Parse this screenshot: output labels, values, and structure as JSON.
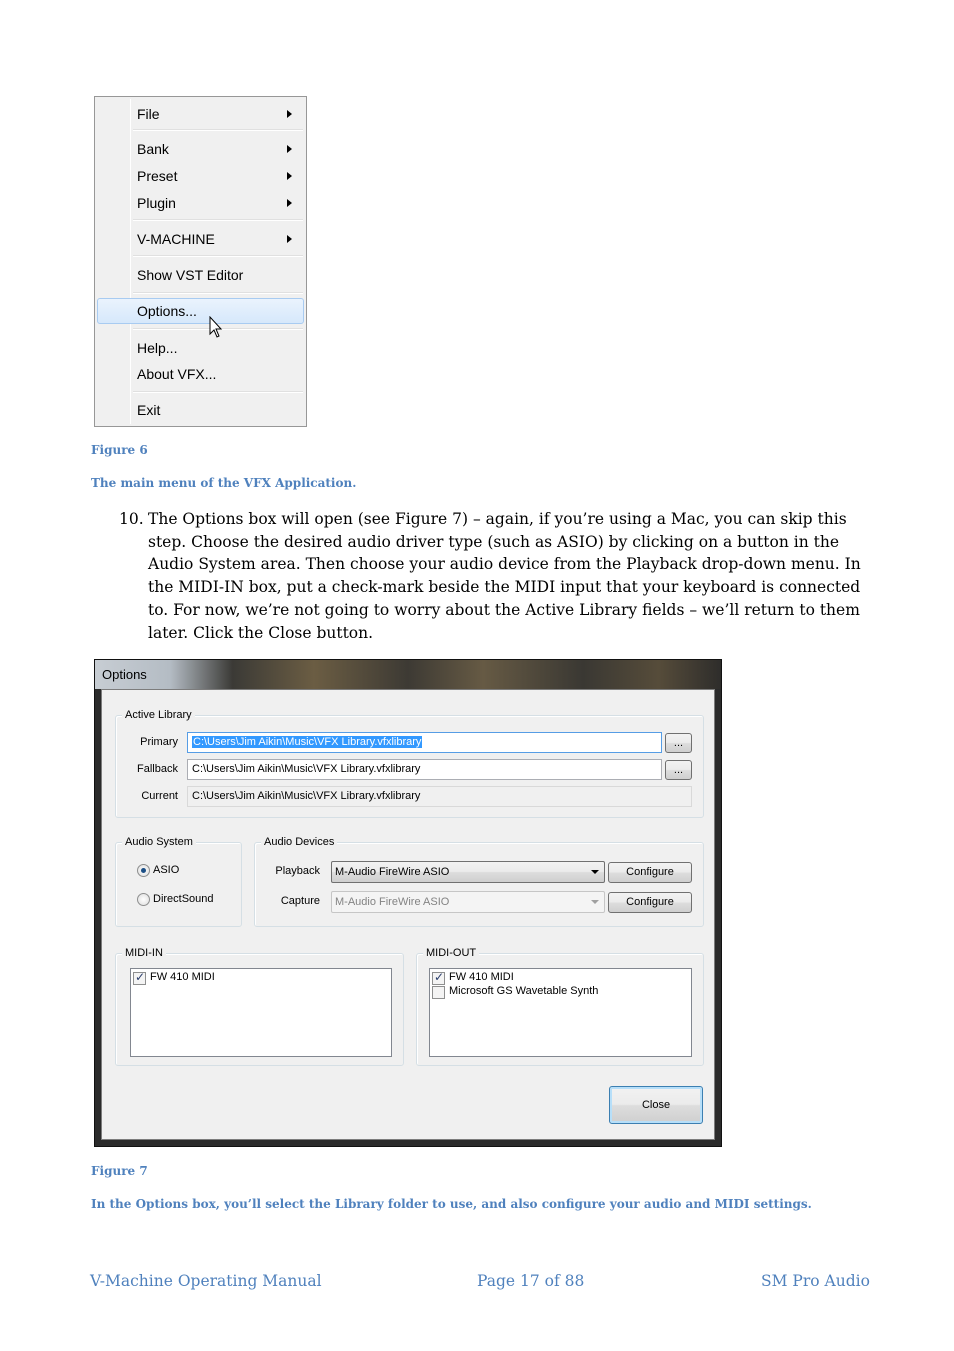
{
  "menu": {
    "items": [
      {
        "label": "File",
        "submenu": true
      },
      {
        "label": "Bank",
        "submenu": true
      },
      {
        "label": "Preset",
        "submenu": true
      },
      {
        "label": "Plugin",
        "submenu": true
      },
      {
        "label": "V-MACHINE",
        "submenu": true
      },
      {
        "label": "Show VST Editor",
        "submenu": false
      },
      {
        "label": "Options...",
        "submenu": false,
        "highlighted": true
      },
      {
        "label": "Help...",
        "submenu": false
      },
      {
        "label": "About VFX...",
        "submenu": false
      },
      {
        "label": "Exit",
        "submenu": false
      }
    ]
  },
  "figure6": {
    "label": "Figure 6",
    "caption": "The main menu of the VFX Application."
  },
  "step": {
    "number": "10.",
    "text": "The Options box will open (see Figure 7) – again, if you’re using a Mac, you can skip this step. Choose the desired audio driver type (such as ASIO) by clicking on a button in the Audio System area. Then choose your audio device from the Playback drop-down menu. In the MIDI-IN box, put a check-mark beside the MIDI input that your keyboard is connected to. For now, we’re not going to worry about the Active Library fields – we’ll return to them later. Click the Close button."
  },
  "dialog": {
    "title": "Options",
    "active_library": {
      "legend": "Active Library",
      "primary_label": "Primary",
      "primary_value": "C:\\Users\\Jim Aikin\\Music\\VFX Library.vfxlibrary",
      "fallback_label": "Fallback",
      "fallback_value": "C:\\Users\\Jim Aikin\\Music\\VFX Library.vfxlibrary",
      "current_label": "Current",
      "current_value": "C:\\Users\\Jim Aikin\\Music\\VFX Library.vfxlibrary",
      "browse_label": "..."
    },
    "audio_system": {
      "legend": "Audio System",
      "asio_label": "ASIO",
      "asio_selected": true,
      "directsound_label": "DirectSound",
      "directsound_selected": false
    },
    "audio_devices": {
      "legend": "Audio Devices",
      "playback_label": "Playback",
      "playback_value": "M-Audio FireWire ASIO",
      "capture_label": "Capture",
      "capture_value": "M-Audio FireWire ASIO",
      "configure_label": "Configure"
    },
    "midi_in": {
      "legend": "MIDI-IN",
      "items": [
        {
          "label": "FW 410 MIDI",
          "checked": true
        }
      ]
    },
    "midi_out": {
      "legend": "MIDI-OUT",
      "items": [
        {
          "label": "FW 410 MIDI",
          "checked": true
        },
        {
          "label": "Microsoft GS Wavetable Synth",
          "checked": false
        }
      ]
    },
    "close_label": "Close"
  },
  "figure7": {
    "label": "Figure 7",
    "caption": "In the Options box, you’ll select the Library folder to use, and also configure your audio and MIDI settings."
  },
  "footer": {
    "left": "V-Machine Operating Manual",
    "center": "Page 17 of 88",
    "right": "SM Pro Audio"
  },
  "colors": {
    "caption": "#4f81bd",
    "menu_highlight": "#d6e8fb",
    "selection": "#3399ff"
  }
}
